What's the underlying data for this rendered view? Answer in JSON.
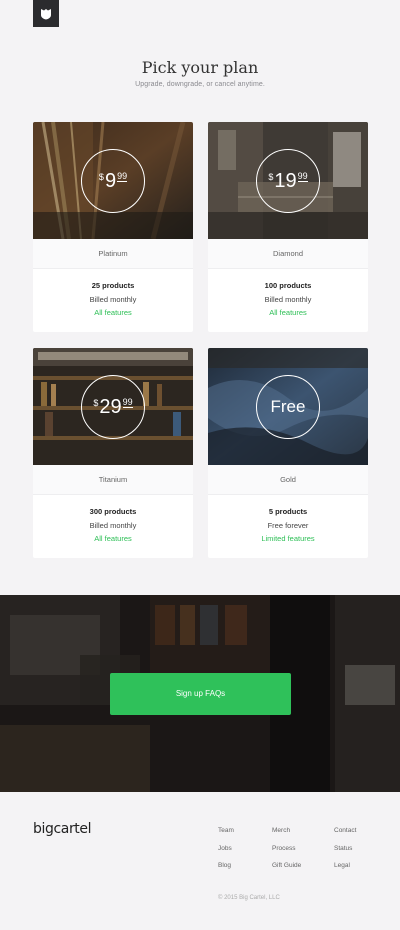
{
  "hero": {
    "title": "Pick your plan",
    "subtitle": "Upgrade, downgrade, or cancel anytime."
  },
  "plans": [
    {
      "currency": "$",
      "whole": "9",
      "cents": "99",
      "name": "Platinum",
      "products": "25 products",
      "billing": "Billed monthly",
      "features": "All features"
    },
    {
      "currency": "$",
      "whole": "19",
      "cents": "99",
      "name": "Diamond",
      "products": "100 products",
      "billing": "Billed monthly",
      "features": "All features"
    },
    {
      "currency": "$",
      "whole": "29",
      "cents": "99",
      "name": "Titanium",
      "products": "300 products",
      "billing": "Billed monthly",
      "features": "All features"
    },
    {
      "free": "Free",
      "name": "Gold",
      "products": "5 products",
      "billing": "Free forever",
      "features": "Limited features"
    }
  ],
  "signup": {
    "button_label": "Sign up FAQs"
  },
  "footer": {
    "logo": "bigcartel",
    "col1": [
      "Team",
      "Jobs",
      "Blog"
    ],
    "col2": [
      "Merch",
      "Process",
      "Gift Guide"
    ],
    "col3": [
      "Contact",
      "Status",
      "Legal"
    ],
    "copyright": "© 2015 Big Cartel, LLC"
  },
  "colors": {
    "accent": "#2fc15a",
    "feature_text": "#2dbf56",
    "logo_bg": "#2b2b2e"
  }
}
